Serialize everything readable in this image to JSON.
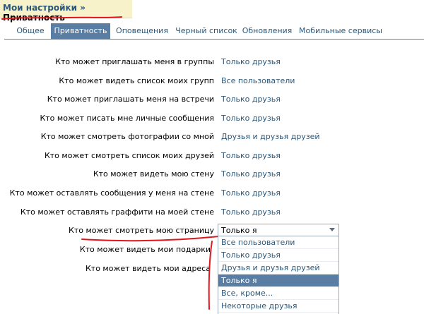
{
  "breadcrumb": {
    "parent": "Мои настройки",
    "separator": "»",
    "current": "Приватность"
  },
  "tabs": [
    {
      "label": "Общее"
    },
    {
      "label": "Приватность"
    },
    {
      "label": "Оповещения"
    },
    {
      "label": "Черный список"
    },
    {
      "label": "Обновления"
    },
    {
      "label": "Мобильные сервисы"
    }
  ],
  "settings": [
    {
      "label": "Кто может приглашать меня в группы",
      "value": "Только друзья"
    },
    {
      "label": "Кто может видеть список моих групп",
      "value": "Все пользователи"
    },
    {
      "label": "Кто может приглашать меня на встречи",
      "value": "Только друзья"
    },
    {
      "label": "Кто может писать мне личные сообщения",
      "value": "Только друзья"
    },
    {
      "label": "Кто может смотреть фотографии со мной",
      "value": "Друзья и друзья друзей"
    },
    {
      "label": "Кто может смотреть список моих друзей",
      "value": "Только друзья"
    },
    {
      "label": "Кто может видеть мою стену",
      "value": "Только друзья"
    },
    {
      "label": "Кто может оставлять сообщения у меня на стене",
      "value": "Только друзья"
    },
    {
      "label": "Кто может оставлять граффити на моей стене",
      "value": "Только друзья"
    },
    {
      "label": "Кто может смотреть мою страницу",
      "value": ""
    },
    {
      "label": "Кто может видеть мои подарки",
      "value": ""
    },
    {
      "label": "Кто может видеть мои адреса",
      "value": ""
    }
  ],
  "dropdown": {
    "selected": "Только я",
    "options": [
      {
        "label": "Все пользователи"
      },
      {
        "label": "Только друзья"
      },
      {
        "label": "Друзья и друзья друзей"
      },
      {
        "label": "Только я"
      },
      {
        "label": "Все, кроме..."
      },
      {
        "label": "Некоторые друзья"
      }
    ]
  },
  "colors": {
    "accent": "#597da3",
    "link": "#2b587a",
    "annotation": "#e0161d"
  }
}
